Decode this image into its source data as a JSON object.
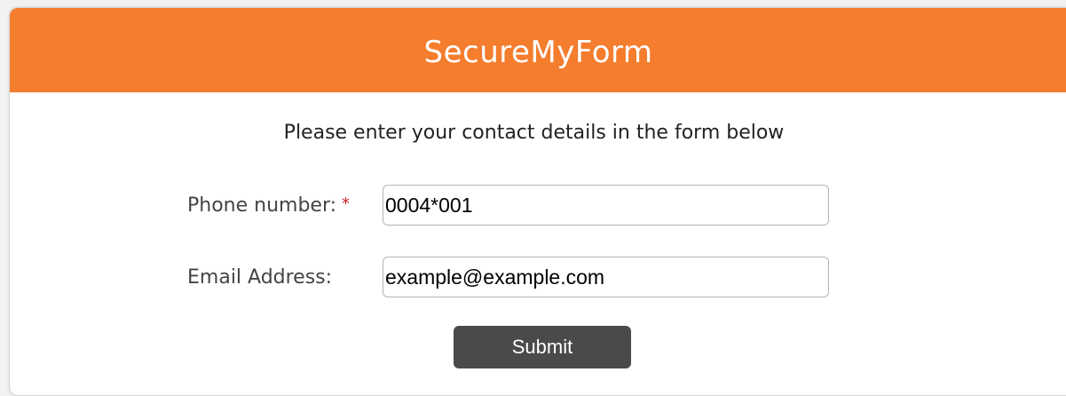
{
  "header": {
    "title": "SecureMyForm"
  },
  "form": {
    "intro": "Please enter your contact details in the form below",
    "phone": {
      "label": "Phone number:",
      "required_marker": "*",
      "value": "0004*001"
    },
    "email": {
      "label": "Email Address:",
      "value": "example@example.com"
    },
    "submit_label": "Submit"
  },
  "colors": {
    "header_bg": "#f47d2e",
    "button_bg": "#4a4a4a",
    "required": "#cc2222"
  }
}
